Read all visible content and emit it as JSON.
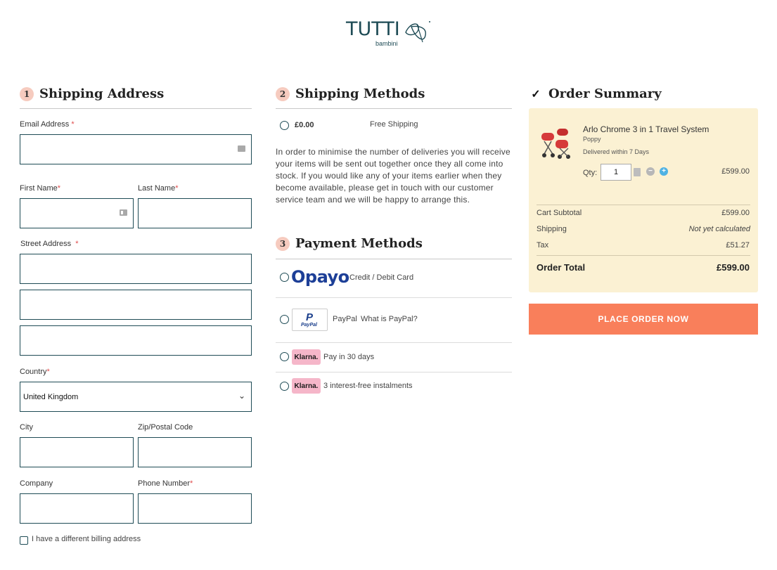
{
  "brand": {
    "name": "TUTTI",
    "sub": "bambini",
    "color": "#1e4b55"
  },
  "shipping_address": {
    "step": "1",
    "title": "Shipping Address",
    "email_label": "Email Address",
    "first_name_label": "First Name",
    "last_name_label": "Last Name",
    "street_label": "Street Address",
    "country_label": "Country",
    "country_value": "United Kingdom",
    "city_label": "City",
    "zip_label": "Zip/Postal Code",
    "company_label": "Company",
    "phone_label": "Phone Number",
    "required_mark": "*",
    "billing_checkbox_label": "I have a different billing address"
  },
  "shipping_methods": {
    "step": "2",
    "title": "Shipping Methods",
    "option_price": "£0.00",
    "option_name": "Free Shipping",
    "note": "In order to minimise the number of deliveries you will receive your items will be sent out together once they all come into stock. If you would like any of your items earlier when they become available, please get in touch with our customer service team and we will be happy to arrange this."
  },
  "payment_methods": {
    "step": "3",
    "title": "Payment Methods",
    "opayo_logo": "Opayo",
    "opayo_label": "Credit / Debit Card",
    "paypal_logo_mark": "P",
    "paypal_logo_text": "PayPal",
    "paypal_label": "PayPal",
    "paypal_link": "What is PayPal?",
    "klarna_logo": "Klarna.",
    "klarna_30_label": "Pay in 30 days",
    "klarna_instalments_label": "3 interest-free instalments"
  },
  "order_summary": {
    "title": "Order Summary",
    "check_icon": "check-icon",
    "product_name": "Arlo Chrome 3 in 1 Travel System",
    "product_variant": "Poppy",
    "product_delivery": "Delivered within 7 Days",
    "qty_label": "Qty:",
    "qty_value": "1",
    "line_price": "£599.00",
    "subtotal_label": "Cart Subtotal",
    "subtotal_value": "£599.00",
    "shipping_label": "Shipping",
    "shipping_value": "Not yet calculated",
    "tax_label": "Tax",
    "tax_value": "£51.27",
    "total_label": "Order Total",
    "total_value": "£599.00",
    "bg_color": "#fbf1d3"
  },
  "place_order": {
    "label": "PLACE ORDER NOW",
    "color": "#f97f5b"
  }
}
